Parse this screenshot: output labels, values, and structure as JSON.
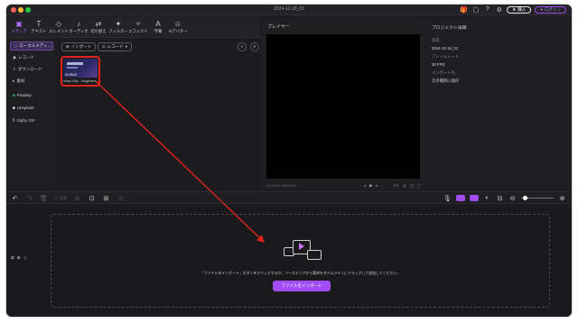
{
  "window": {
    "title": "2024-12-18_01",
    "upgrade_label": "購入",
    "account_label": "ログイン",
    "accent": "#a14cf5"
  },
  "toolbar": {
    "items": [
      {
        "label": "メディア",
        "icon": "folder-icon"
      },
      {
        "label": "テキスト",
        "icon": "text-icon"
      },
      {
        "label": "エレメント",
        "icon": "shapes-icon"
      },
      {
        "label": "オーディオ",
        "icon": "music-note-icon"
      },
      {
        "label": "切り替え",
        "icon": "transition-icon"
      },
      {
        "label": "フィルター",
        "icon": "sparkle-icon"
      },
      {
        "label": "エフェクト",
        "icon": "effect-icon"
      },
      {
        "label": "字幕",
        "icon": "caption-icon"
      },
      {
        "label": "AIアバター",
        "icon": "avatar-icon"
      }
    ]
  },
  "sidebar": {
    "items": [
      {
        "label": "ローカルメディ…",
        "active": true
      },
      {
        "label": "レコード"
      },
      {
        "label": "ダウンロード"
      },
      {
        "label": "素材"
      },
      {
        "label": "Pixabay"
      },
      {
        "label": "Unsplash"
      },
      {
        "label": "Giphy GIF"
      }
    ]
  },
  "media": {
    "import_label": "インポート",
    "record_label": "レコード",
    "clip_name": "Video Edit... Beginners",
    "clip_duration": "00:05:02"
  },
  "player": {
    "header": "プレイヤー",
    "timecode": "00:00:00 / 00:00:00",
    "quality": "フル"
  },
  "project": {
    "header": "プロジェクト詳細",
    "fields": [
      {
        "label": "名前:",
        "value": "2024-12-18_01"
      },
      {
        "label": "フレームレート:",
        "value": "30 FPS"
      },
      {
        "label": "インポート先:",
        "value": "元の場所に保存"
      }
    ]
  },
  "timeline": {
    "empty_message": "「ファイルをインポート」ボタンをクリックするか、ソースエリアから素材をタイムラインにドラッグして追加してください。",
    "import_button": "ファイルをインポート",
    "split_label": "分割",
    "zoom": 45
  }
}
